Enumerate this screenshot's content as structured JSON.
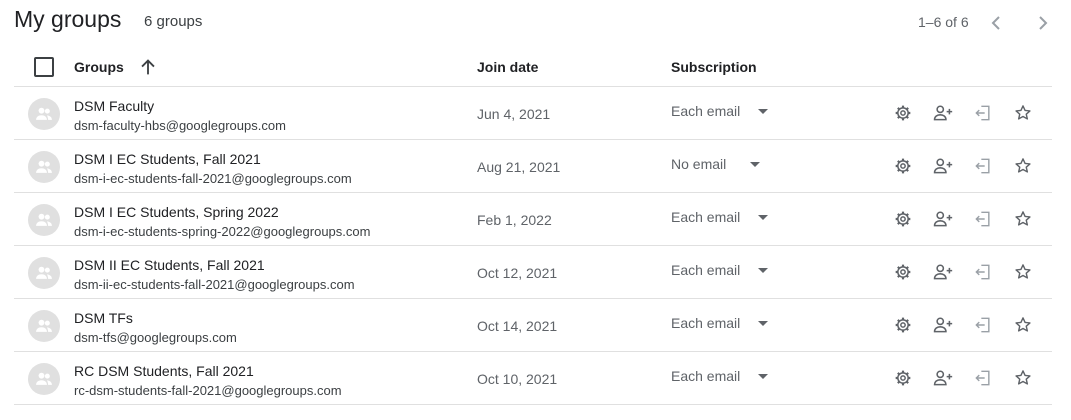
{
  "header": {
    "title": "My groups",
    "count": "6 groups",
    "pagination": "1–6 of 6"
  },
  "columns": {
    "groups": "Groups",
    "join_date": "Join date",
    "subscription": "Subscription"
  },
  "rows": [
    {
      "name": "DSM Faculty",
      "email": "dsm-faculty-hbs@googlegroups.com",
      "date": "Jun 4, 2021",
      "subscription": "Each email"
    },
    {
      "name": "DSM I EC Students, Fall 2021",
      "email": "dsm-i-ec-students-fall-2021@googlegroups.com",
      "date": "Aug 21, 2021",
      "subscription": "No email"
    },
    {
      "name": "DSM I EC Students, Spring 2022",
      "email": "dsm-i-ec-students-spring-2022@googlegroups.com",
      "date": "Feb 1, 2022",
      "subscription": "Each email"
    },
    {
      "name": "DSM II EC Students, Fall 2021",
      "email": "dsm-ii-ec-students-fall-2021@googlegroups.com",
      "date": "Oct 12, 2021",
      "subscription": "Each email"
    },
    {
      "name": "DSM TFs",
      "email": "dsm-tfs@googlegroups.com",
      "date": "Oct 14, 2021",
      "subscription": "Each email"
    },
    {
      "name": "RC DSM Students, Fall 2021",
      "email": "rc-dsm-students-fall-2021@googlegroups.com",
      "date": "Oct 10, 2021",
      "subscription": "Each email"
    }
  ],
  "icons": {
    "row_actions": [
      "gear-icon",
      "person-add-icon",
      "exit-icon",
      "star-outline-icon"
    ],
    "avatar": "group-icon",
    "sort": "arrow-upward-icon"
  },
  "colors": {
    "text_primary": "#202124",
    "text_secondary": "#5f6368",
    "divider": "#e0e0e0",
    "avatar_bg": "#e0e0e0"
  }
}
